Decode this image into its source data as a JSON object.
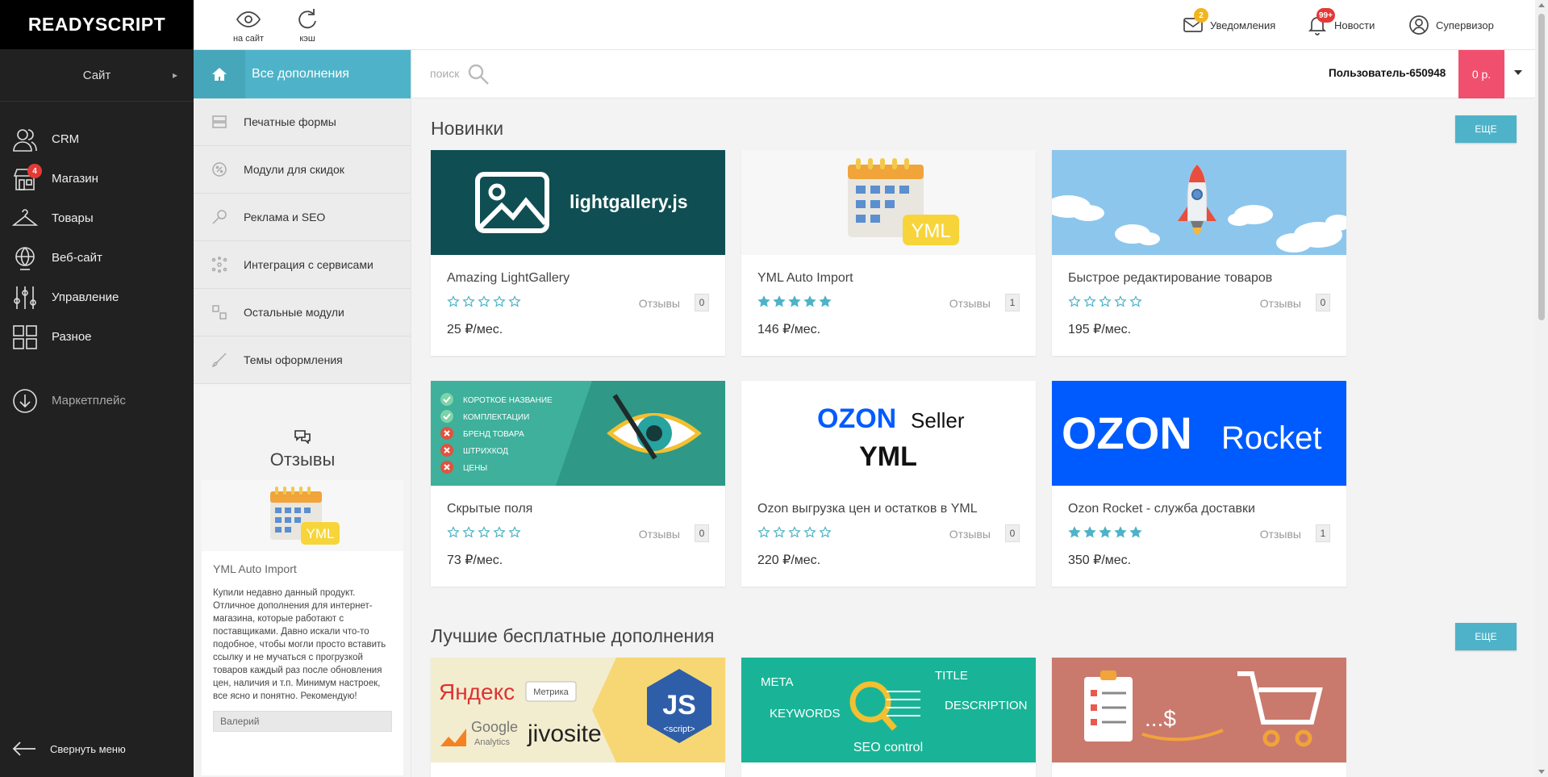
{
  "brand": {
    "logo": "READYSCRIPT"
  },
  "sidebar": {
    "site_label": "Сайт",
    "items": [
      {
        "label": "CRM",
        "icon": "users-icon"
      },
      {
        "label": "Магазин",
        "icon": "store-icon",
        "badge": "4"
      },
      {
        "label": "Товары",
        "icon": "hanger-icon"
      },
      {
        "label": "Веб-сайт",
        "icon": "globe-icon"
      },
      {
        "label": "Управление",
        "icon": "sliders-icon"
      },
      {
        "label": "Разное",
        "icon": "grid-icon"
      }
    ],
    "marketplace": {
      "label": "Маркетплейс",
      "icon": "download-circle-icon"
    },
    "collapse_label": "Свернуть меню"
  },
  "topbar": {
    "to_site": "на сайт",
    "cache": "кэш",
    "notifications": {
      "label": "Уведомления",
      "count": "2"
    },
    "news": {
      "label": "Новости",
      "count": "99+"
    },
    "supervisor": "Супервизор"
  },
  "categories": {
    "all": "Все дополнения",
    "items": [
      "Печатные формы",
      "Модули для скидок",
      "Реклама и SEO",
      "Интеграция с сервисами",
      "Остальные модули",
      "Темы оформления"
    ]
  },
  "review": {
    "title": "Отзывы",
    "product": "YML Auto Import",
    "text": "Купили недавно данный продукт. Отличное дополнения для интернет-магазина, которые работают с поставщиками. Давно искали что-то подобное, чтобы могли просто вставить ссылку и не мучаться с прогрузкой товаров каждый раз после обновления цен, наличия и т.п. Минимум настроек, все ясно и понятно. Рекомендую!",
    "author": "Валерий"
  },
  "search": {
    "placeholder": "поиск"
  },
  "account": {
    "user": "Пользователь-650948",
    "balance": "0 р."
  },
  "sections": {
    "new": {
      "title": "Новинки",
      "more": "ЕЩЕ"
    },
    "free": {
      "title": "Лучшие бесплатные дополнения",
      "more": "ЕЩЕ"
    }
  },
  "reviews_label": "Отзывы",
  "new_cards": [
    {
      "title": "Amazing LightGallery",
      "stars": 0,
      "reviews": "0",
      "price": "25 ₽/мес.",
      "image_text": "lightgallery.js"
    },
    {
      "title": "YML Auto Import",
      "stars": 5,
      "reviews": "1",
      "price": "146 ₽/мес.",
      "image_text": "YML"
    },
    {
      "title": "Быстрое редактирование товаров",
      "stars": 0,
      "reviews": "0",
      "price": "195 ₽/мес."
    },
    {
      "title": "Скрытые поля",
      "stars": 0,
      "reviews": "0",
      "price": "73 ₽/мес.",
      "image_list": [
        "КОРОТКОЕ НАЗВАНИЕ",
        "КОМПЛЕКТАЦИИ",
        "БРЕНД ТОВАРА",
        "ШТРИХКОД",
        "ЦЕНЫ"
      ]
    },
    {
      "title": "Ozon выгрузка цен и остатков в YML",
      "stars": 0,
      "reviews": "0",
      "price": "220 ₽/мес.",
      "image_text": "OZON",
      "image_sub": "Seller",
      "image_yml": "YML"
    },
    {
      "title": "Ozon Rocket - служба доставки",
      "stars": 5,
      "reviews": "1",
      "price": "350 ₽/мес.",
      "image_text": "OZON",
      "image_sub": "Rocket"
    }
  ],
  "free_cards": [
    {
      "image_words": [
        "Яндекс",
        "Метрика",
        "Google",
        "Analytics",
        "jivosite",
        "JS",
        "<script>"
      ]
    },
    {
      "image_words": [
        "META",
        "TITLE",
        "KEYWORDS",
        "DESCRIPTION",
        "SEO control"
      ]
    },
    {
      "image_words": [
        "...$"
      ]
    }
  ],
  "colors": {
    "accent": "#4eb3c8",
    "balance": "#f0506e",
    "sidebar": "#212121",
    "ozon": "#005bff"
  }
}
